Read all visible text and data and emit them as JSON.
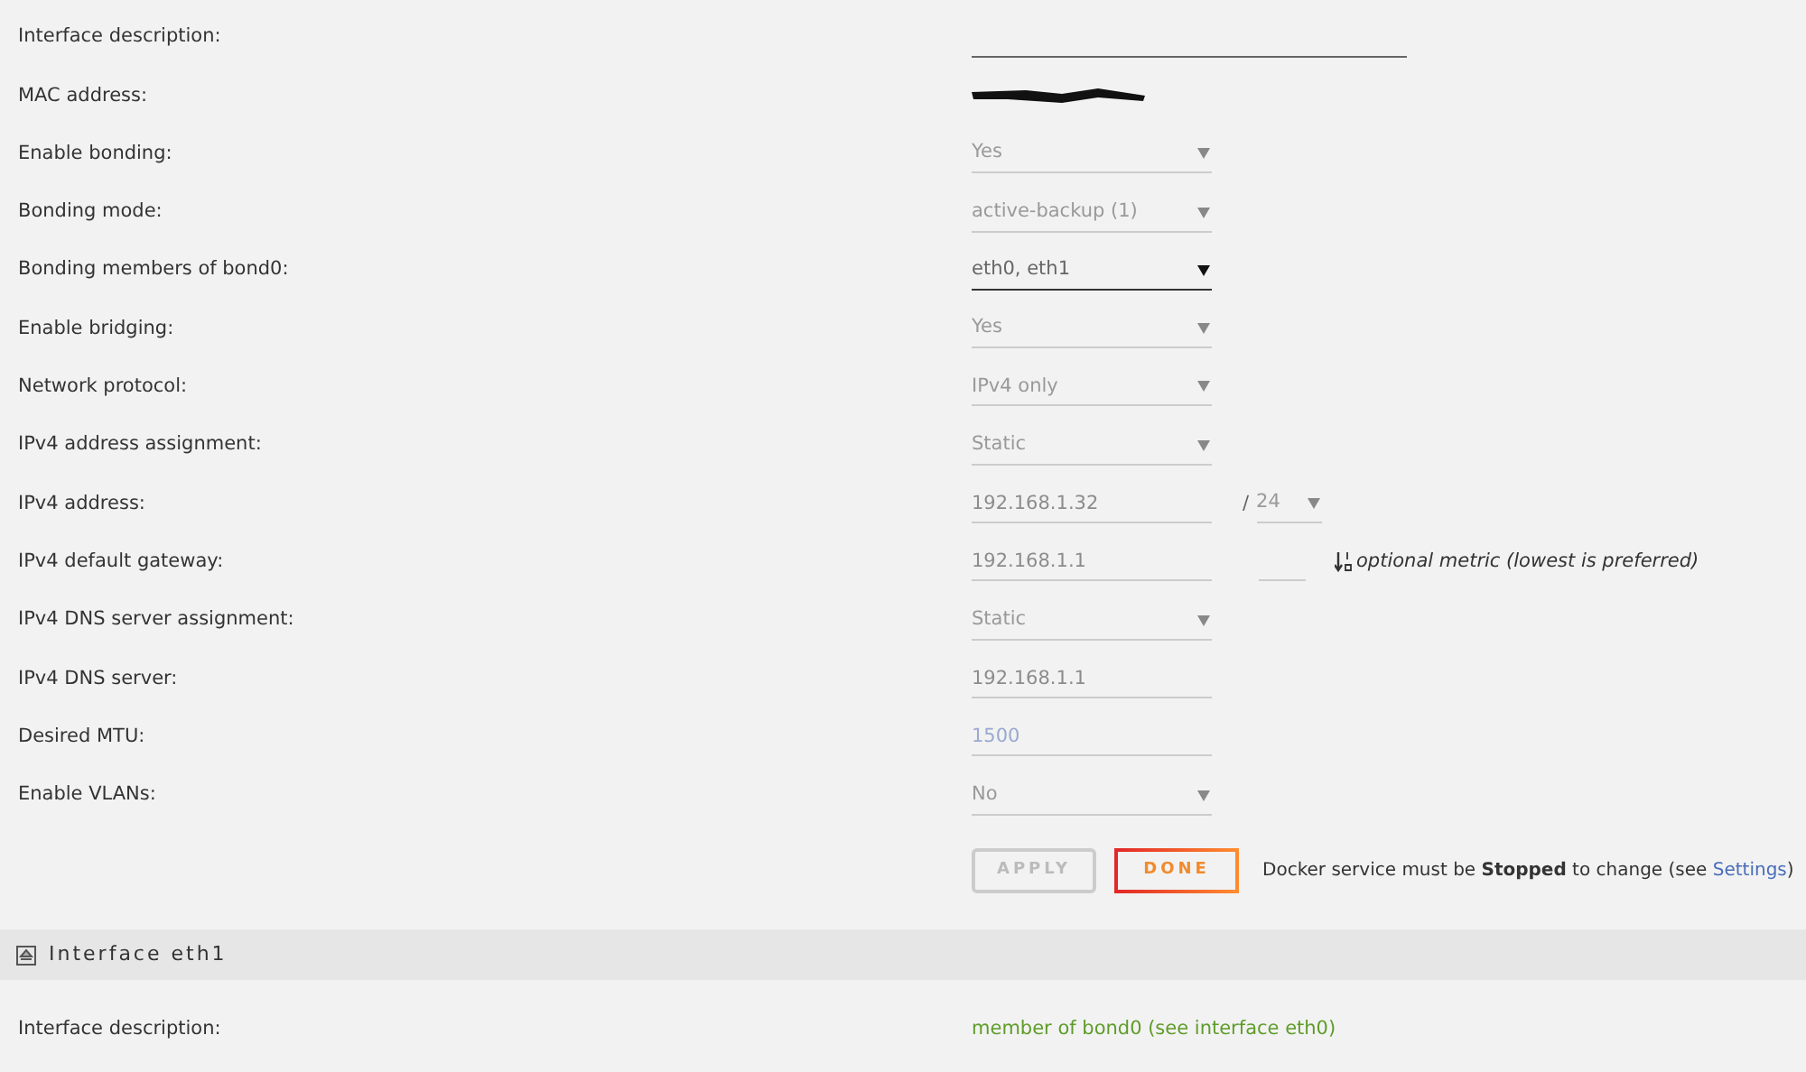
{
  "interface_eth0": {
    "rows": [
      {
        "label": "Interface description:",
        "kind": "wide-text"
      },
      {
        "label": "MAC address:",
        "kind": "redacted"
      },
      {
        "label": "Enable bonding:",
        "kind": "select",
        "value": "Yes",
        "disabled": true
      },
      {
        "label": "Bonding mode:",
        "kind": "select",
        "value": "active-backup (1)",
        "disabled": true
      },
      {
        "label": "Bonding members of bond0:",
        "kind": "select",
        "value": "eth0, eth1",
        "disabled": false
      },
      {
        "label": "Enable bridging:",
        "kind": "select",
        "value": "Yes",
        "disabled": true
      },
      {
        "label": "Network protocol:",
        "kind": "select",
        "value": "IPv4 only",
        "disabled": true
      },
      {
        "label": "IPv4 address assignment:",
        "kind": "select",
        "value": "Static",
        "disabled": true
      },
      {
        "label": "IPv4 address:",
        "kind": "ip",
        "value": "192.168.1.32",
        "separator": "/",
        "prefix": "24"
      },
      {
        "label": "IPv4 default gateway:",
        "kind": "gateway",
        "value": "192.168.1.1",
        "metric_hint": "optional metric (lowest is preferred)"
      },
      {
        "label": "IPv4 DNS server assignment:",
        "kind": "select",
        "value": "Static",
        "disabled": true
      },
      {
        "label": "IPv4 DNS server:",
        "kind": "text",
        "value": "192.168.1.1"
      },
      {
        "label": "Desired MTU:",
        "kind": "text",
        "placeholder": "1500"
      },
      {
        "label": "Enable VLANs:",
        "kind": "select",
        "value": "No",
        "disabled": true
      }
    ],
    "buttons": [
      {
        "label": "APPLY",
        "disabled": true
      },
      {
        "label": "DONE",
        "disabled": false
      }
    ],
    "note": {
      "text": "Docker service must be **Stopped** to change (see ",
      "link": "Settings",
      "after": ")"
    }
  },
  "interface_eth1": {
    "title": "Interface eth1",
    "rows": [
      {
        "label": "Interface description:",
        "kind": "info",
        "value": "member of bond0 (see interface eth0)"
      }
    ]
  }
}
